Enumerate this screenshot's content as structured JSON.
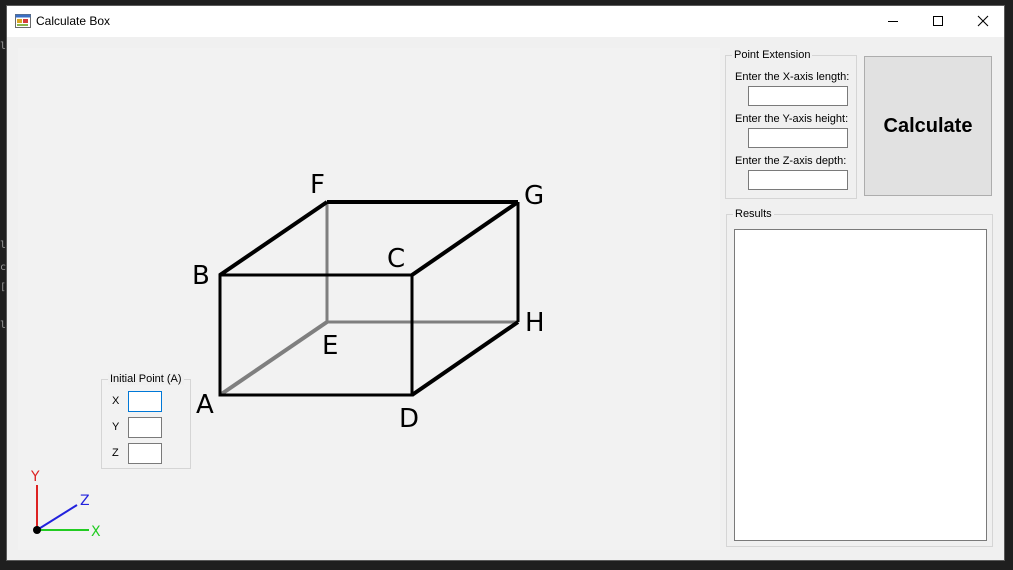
{
  "window": {
    "title": "Calculate Box"
  },
  "initial_point": {
    "title": "Initial Point (A)",
    "x_label": "X",
    "y_label": "Y",
    "z_label": "Z",
    "x_value": "",
    "y_value": "",
    "z_value": ""
  },
  "point_extension": {
    "title": "Point Extension",
    "x_prompt": "Enter the X-axis length:",
    "y_prompt": "Enter the Y-axis height:",
    "z_prompt": "Enter the Z-axis depth:",
    "x_value": "",
    "y_value": "",
    "z_value": ""
  },
  "calculate_label": "Calculate",
  "results": {
    "title": "Results",
    "content": ""
  },
  "box_diagram": {
    "vertices": [
      "A",
      "B",
      "C",
      "D",
      "E",
      "F",
      "G",
      "H"
    ],
    "hidden_edge_color": "#7f7f7f",
    "visible_edge_color": "#000000"
  },
  "axes_gizmo": {
    "x_label": "X",
    "y_label": "Y",
    "z_label": "Z",
    "x_color": "#22cc22",
    "y_color": "#dd2222",
    "z_color": "#2222dd"
  }
}
